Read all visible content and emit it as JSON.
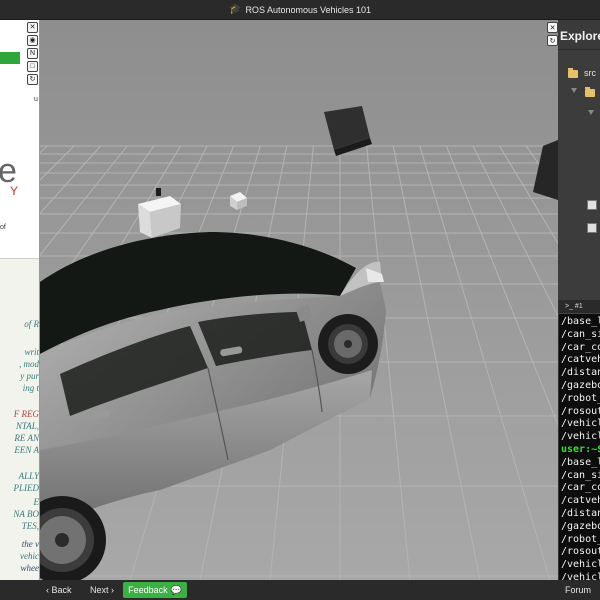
{
  "titlebar": {
    "icon": "graduation-cap-icon",
    "title": "ROS Autonomous Vehicles 101"
  },
  "notebook": {
    "fragment_u": "u",
    "fragment_e": "e",
    "fragment_y": "Y",
    "fragment_of": "of",
    "code_lines": [
      {
        "text": "of R",
        "style": "teal"
      },
      {
        "text": "writ",
        "style": "teal"
      },
      {
        "text": ", mod",
        "style": "teal"
      },
      {
        "text": "y pur",
        "style": "teal"
      },
      {
        "text": "ing t",
        "style": "teal"
      },
      {
        "text": "F REG",
        "style": "red"
      },
      {
        "text": "NTAL,",
        "style": "teal"
      },
      {
        "text": "RE AN",
        "style": "teal"
      },
      {
        "text": "EEN A",
        "style": "teal"
      },
      {
        "text": "ALLY",
        "style": "teal"
      },
      {
        "text": "PLIED",
        "style": "teal"
      },
      {
        "text": "E",
        "style": "teal"
      },
      {
        "text": "NA BO",
        "style": "teal"
      },
      {
        "text": "TES,",
        "style": "teal"
      },
      {
        "text": "the v",
        "style": "dark"
      },
      {
        "text": "vehic",
        "style": "teal"
      },
      {
        "text": "whee",
        "style": "dark"
      }
    ]
  },
  "toolbar_left": [
    "close-icon",
    "camera-icon",
    "n-icon",
    "square-icon",
    "refresh-icon"
  ],
  "toolbar_left_glyphs": [
    "✕",
    "◉",
    "N",
    "□",
    "↻"
  ],
  "toolbar_right_glyphs": [
    "✕",
    "↻"
  ],
  "explorer": {
    "title": "Explore",
    "root": "src"
  },
  "terminal": {
    "tab": ">_ #1",
    "lines": [
      {
        "text": "/base_l",
        "user": false
      },
      {
        "text": "/can_si",
        "user": false
      },
      {
        "text": "/car_co",
        "user": false
      },
      {
        "text": "/catveh",
        "user": false
      },
      {
        "text": "/distan",
        "user": false
      },
      {
        "text": "/gazebo",
        "user": false
      },
      {
        "text": "/robot_",
        "user": false
      },
      {
        "text": "/rosout",
        "user": false
      },
      {
        "text": "/vehicl",
        "user": false
      },
      {
        "text": "/vehicl",
        "user": false
      },
      {
        "text": "user:~$",
        "user": true
      },
      {
        "text": "/base_l",
        "user": false
      },
      {
        "text": "/can_si",
        "user": false
      },
      {
        "text": "/car_co",
        "user": false
      },
      {
        "text": "/catveh",
        "user": false
      },
      {
        "text": "/distan",
        "user": false
      },
      {
        "text": "/gazebo",
        "user": false
      },
      {
        "text": "/robot_",
        "user": false
      },
      {
        "text": "/rosout",
        "user": false
      },
      {
        "text": "/vehicl",
        "user": false
      },
      {
        "text": "/vehicl",
        "user": false
      }
    ]
  },
  "bottombar": {
    "back": "‹ Back",
    "next": "Next ›",
    "feedback": "Feedback",
    "forum": "Forum"
  },
  "colors": {
    "accent_green": "#3cb043",
    "terminal_user": "#3ddc3d",
    "viewport_bg": "#9a9a9a"
  }
}
